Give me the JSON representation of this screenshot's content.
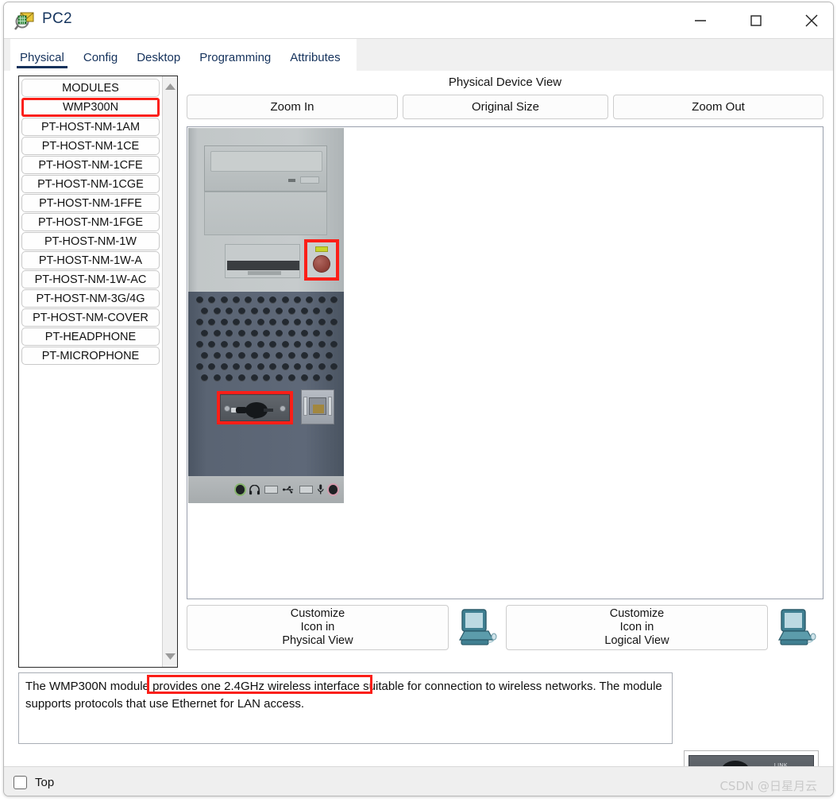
{
  "window": {
    "title": "PC2",
    "app_icon": "packet-tracer-icon",
    "controls": {
      "minimize": "minimize-icon",
      "maximize": "maximize-icon",
      "close": "close-icon"
    }
  },
  "tabs": [
    {
      "label": "Physical",
      "active": true
    },
    {
      "label": "Config",
      "active": false
    },
    {
      "label": "Desktop",
      "active": false
    },
    {
      "label": "Programming",
      "active": false
    },
    {
      "label": "Attributes",
      "active": false
    }
  ],
  "modules": {
    "header": "MODULES",
    "selected": "WMP300N",
    "items": [
      "WMP300N",
      "PT-HOST-NM-1AM",
      "PT-HOST-NM-1CE",
      "PT-HOST-NM-1CFE",
      "PT-HOST-NM-1CGE",
      "PT-HOST-NM-1FFE",
      "PT-HOST-NM-1FGE",
      "PT-HOST-NM-1W",
      "PT-HOST-NM-1W-A",
      "PT-HOST-NM-1W-AC",
      "PT-HOST-NM-3G/4G",
      "PT-HOST-NM-COVER",
      "PT-HEADPHONE",
      "PT-MICROPHONE"
    ],
    "scroll_up_icon": "scroll-up-arrow-icon",
    "scroll_down_icon": "scroll-down-arrow-icon"
  },
  "device_view": {
    "title": "Physical Device View",
    "zoom_in": "Zoom In",
    "original_size": "Original Size",
    "zoom_out": "Zoom Out"
  },
  "customize": {
    "physical_line1": "Customize",
    "physical_line2": "Icon in",
    "physical_line3": "Physical View",
    "logical_line1": "Customize",
    "logical_line2": "Icon in",
    "logical_line3": "Logical View",
    "physical_icon": "pc-monitor-icon",
    "logical_icon": "pc-monitor-icon"
  },
  "description": {
    "text": "The WMP300N module provides one 2.4GHz wireless interface suitable for connection to wireless networks. The module supports protocols that use Ethernet for LAN access.",
    "module_preview_label": "LINK"
  },
  "bottom": {
    "top_checkbox_label": "Top",
    "top_checked": false,
    "watermark": "CSDN @日星月云"
  },
  "colors": {
    "highlight": "#fb1f18",
    "tab_active": "#15325c",
    "title_text": "#16355e",
    "chassis_light": "#c6cbcc",
    "chassis_dark": "#5a6473",
    "power_led": "#c8d42a"
  }
}
